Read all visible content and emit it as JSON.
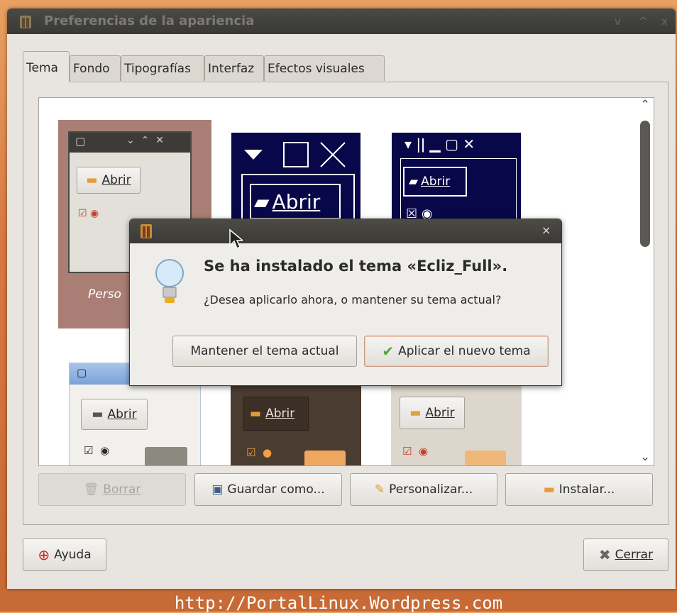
{
  "window": {
    "title": "Preferencias de la apariencia",
    "controls": [
      "v",
      "^",
      "x"
    ]
  },
  "tabs": [
    {
      "label": "Tema",
      "active": true
    },
    {
      "label": "Fondo",
      "active": false
    },
    {
      "label": "Tipografías",
      "active": false
    },
    {
      "label": "Interfaz",
      "active": false
    },
    {
      "label": "Efectos visuales",
      "active": false
    }
  ],
  "themes": {
    "custom_label": "Perso",
    "open_label": "Abrir"
  },
  "actions": {
    "borrar": "Borrar",
    "guardar": "Guardar como...",
    "personalizar": "Personalizar...",
    "instalar": "Instalar..."
  },
  "bottom": {
    "help": "Ayuda",
    "close": "Cerrar"
  },
  "dialog": {
    "close_glyph": "×",
    "heading": "Se ha instalado el tema «Ecliz_Full».",
    "message": "¿Desea aplicarlo ahora, o mantener su tema actual?",
    "keep_button": "Mantener el tema actual",
    "apply_button": "Aplicar el nuevo tema"
  },
  "watermark": "http://PortalLinux.Wordpress.com",
  "colors": {
    "desktop": "#d7793f",
    "titlebar": "#3c3b37",
    "selected_theme": "#a97e74",
    "hc_theme": "#07074a",
    "dark_theme": "#4b3c31"
  }
}
